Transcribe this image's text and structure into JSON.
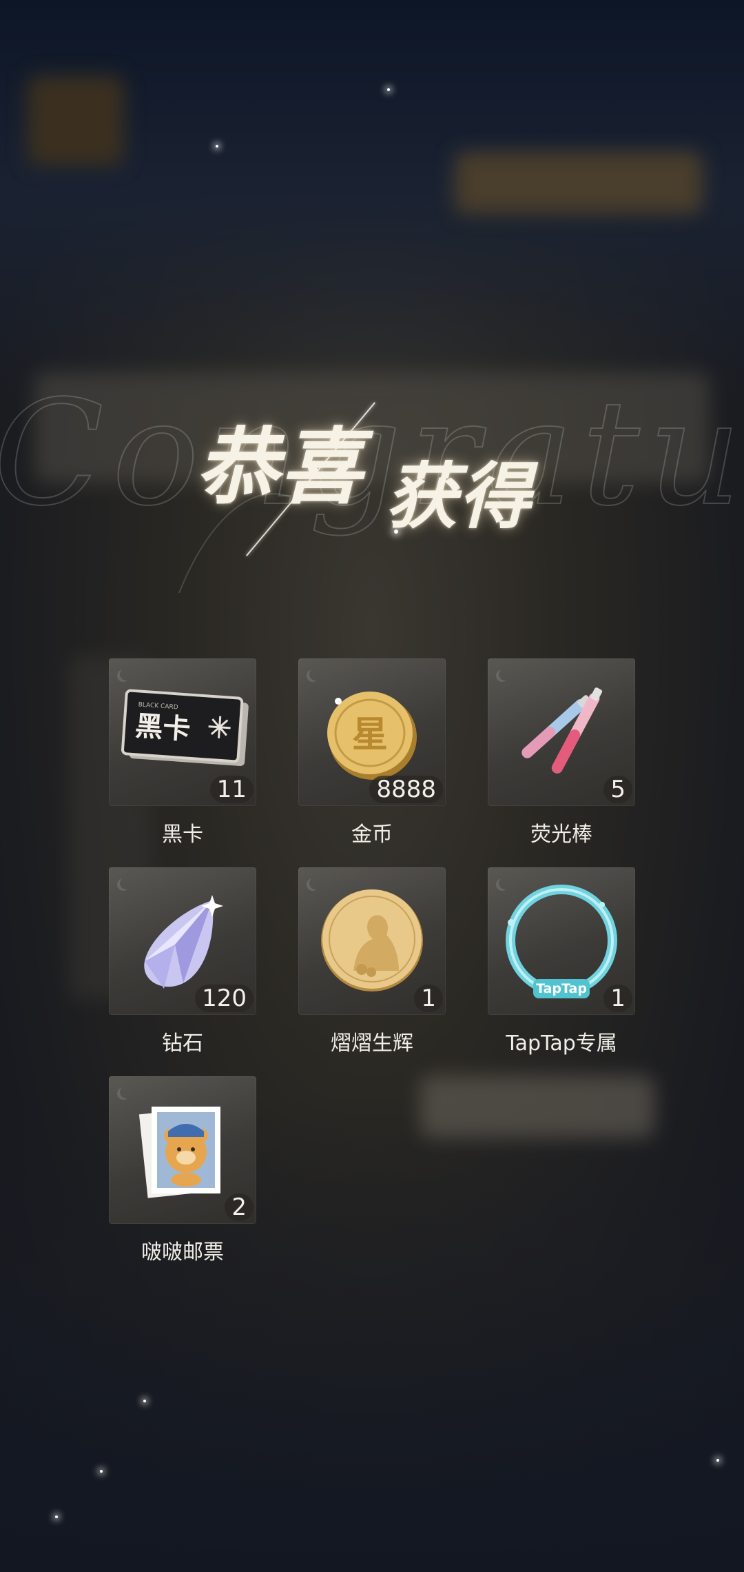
{
  "title": {
    "left": "恭喜",
    "right": "获得",
    "script": "Congratulation"
  },
  "items": [
    {
      "name": "黑卡",
      "count": "11",
      "icon": "black-card-icon",
      "card_text": "黑卡",
      "card_small": "BLACK CARD"
    },
    {
      "name": "金币",
      "count": "8888",
      "icon": "gold-coin-icon",
      "coin_text": "星"
    },
    {
      "name": "荧光棒",
      "count": "5",
      "icon": "glow-stick-icon"
    },
    {
      "name": "钻石",
      "count": "120",
      "icon": "diamond-icon"
    },
    {
      "name": "熠熠生辉",
      "count": "1",
      "icon": "portrait-coin-icon"
    },
    {
      "name": "TapTap专属",
      "count": "1",
      "icon": "avatar-frame-icon",
      "frame_text": "TapTap"
    },
    {
      "name": "啵啵邮票",
      "count": "2",
      "icon": "bear-stamp-icon"
    }
  ],
  "colors": {
    "gold": "#e6c06a",
    "text": "#f1eee7",
    "tile": "#4a4844"
  }
}
